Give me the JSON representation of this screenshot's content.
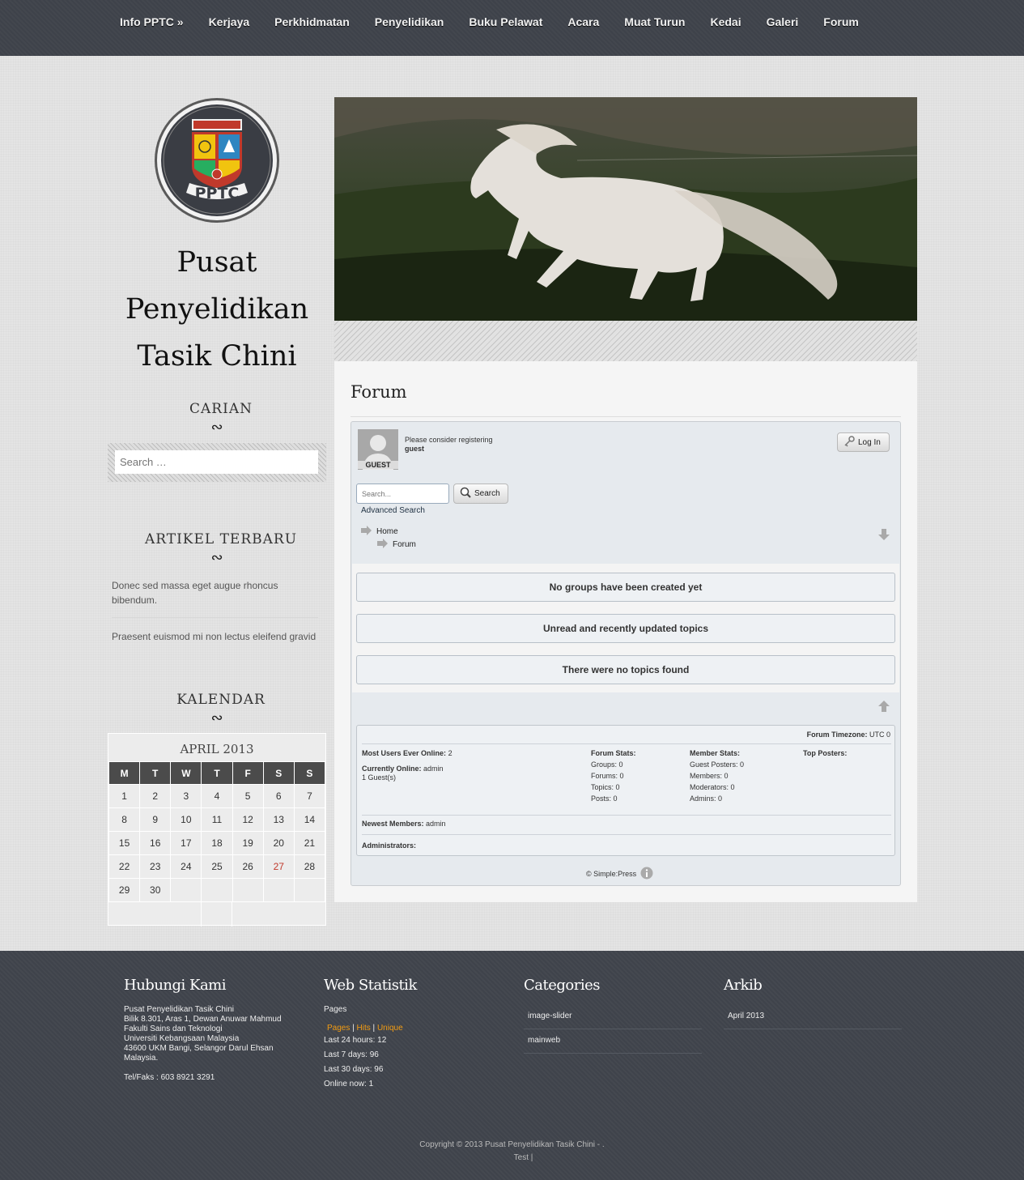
{
  "nav": {
    "items": [
      "Info PPTC »",
      "Kerjaya",
      "Perkhidmatan",
      "Penyelidikan",
      "Buku Pelawat",
      "Acara",
      "Muat Turun",
      "Kedai",
      "Galeri",
      "Forum"
    ]
  },
  "sidebar": {
    "logo_text": "PPTC",
    "site_title_lines": [
      "Pusat",
      "Penyelidikan",
      "Tasik Chini"
    ],
    "search_title": "CARIAN",
    "search_placeholder": "Search …",
    "articles_title": "ARTIKEL TERBARU",
    "articles": [
      "Donec sed massa eget augue rhoncus bibendum.",
      "Praesent euismod mi non lectus eleifend gravid"
    ],
    "calendar_title": "KALENDAR",
    "calendar": {
      "caption": "APRIL 2013",
      "weekdays": [
        "M",
        "T",
        "W",
        "T",
        "F",
        "S",
        "S"
      ],
      "weeks": [
        [
          "1",
          "2",
          "3",
          "4",
          "5",
          "6",
          "7"
        ],
        [
          "8",
          "9",
          "10",
          "11",
          "12",
          "13",
          "14"
        ],
        [
          "15",
          "16",
          "17",
          "18",
          "19",
          "20",
          "21"
        ],
        [
          "22",
          "23",
          "24",
          "25",
          "26",
          "27",
          "28"
        ],
        [
          "29",
          "30",
          "",
          "",
          "",
          "",
          ""
        ]
      ],
      "today": "27"
    }
  },
  "main": {
    "page_title": "Forum",
    "forum": {
      "guest_label": "GUEST",
      "register_note": "Please consider registering",
      "register_user": "guest",
      "login_label": "Log In",
      "search_placeholder": "Search...",
      "search_button": "Search",
      "advanced_search": "Advanced Search",
      "breadcrumb_home": "Home",
      "breadcrumb_forum": "Forum",
      "msg_no_groups": "No groups have been created yet",
      "msg_unread": "Unread and recently updated topics",
      "msg_no_topics": "There were no topics found",
      "stats": {
        "timezone_label": "Forum Timezone:",
        "timezone_value": "UTC 0",
        "most_users_label": "Most Users Ever Online:",
        "most_users_value": "2",
        "currently_label": "Currently Online:",
        "currently_value": "admin",
        "guests": "1 Guest(s)",
        "forum_stats_label": "Forum Stats:",
        "groups": "Groups: 0",
        "forums": "Forums: 0",
        "topics": "Topics: 0",
        "posts": "Posts: 0",
        "member_stats_label": "Member Stats:",
        "guest_posters": "Guest Posters: 0",
        "members": "Members: 0",
        "moderators": "Moderators: 0",
        "admins": "Admins: 0",
        "top_posters_label": "Top Posters:",
        "newest_label": "Newest Members:",
        "newest_value": "admin",
        "administrators_label": "Administrators:"
      },
      "credit": "© Simple:Press"
    }
  },
  "footer": {
    "contact_title": "Hubungi Kami",
    "contact_lines": [
      "Pusat Penyelidikan Tasik Chini",
      "Bilik 8.301, Aras 1, Dewan Anuwar Mahmud",
      "Fakulti Sains dan Teknologi",
      "Universiti Kebangsaan Malaysia",
      "43600 UKM Bangi, Selangor Darul Ehsan",
      "Malaysia."
    ],
    "contact_tel": "Tel/Faks : 603 8921 3291",
    "stats_title": "Web Statistik",
    "stats_pages_label": "Pages",
    "stats_tabs": [
      "Pages",
      "Hits",
      "Unique"
    ],
    "stats_lines": [
      "Last 24 hours: 12",
      "Last 7 days: 96",
      "Last 30 days: 96",
      "Online now: 1"
    ],
    "categories_title": "Categories",
    "categories": [
      "image-slider",
      "mainweb"
    ],
    "archive_title": "Arkib",
    "archive": [
      "April 2013"
    ],
    "copyright_line1": "Copyright © 2013 Pusat Penyelidikan Tasik Chini - .",
    "copyright_line2": "Test |"
  }
}
